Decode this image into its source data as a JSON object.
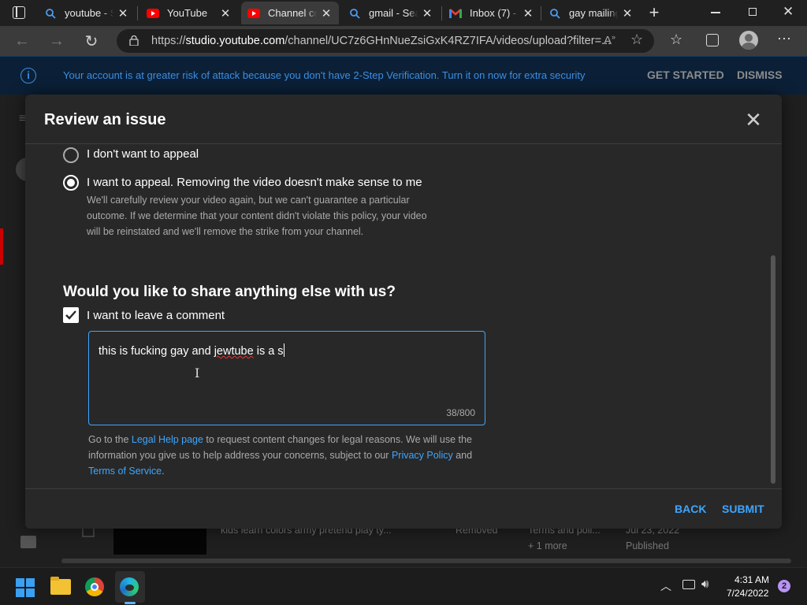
{
  "browser": {
    "tabs": [
      {
        "title": "youtube - S",
        "icon": "search-icon",
        "active": false
      },
      {
        "title": "YouTube",
        "icon": "youtube-icon",
        "active": false
      },
      {
        "title": "Channel co",
        "icon": "youtube-icon",
        "active": true
      },
      {
        "title": "gmail - Sea",
        "icon": "search-icon",
        "active": false
      },
      {
        "title": "Inbox (7) -",
        "icon": "gmail-icon",
        "active": false
      },
      {
        "title": "gay mailing",
        "icon": "search-icon",
        "active": false
      }
    ],
    "new_tab": "+",
    "url_prefix": "https://",
    "url_host": "studio.youtube.com",
    "url_rest": "/channel/UC7z6GHnNueZsiGxK4RZ7IFA/videos/upload?filter=..."
  },
  "infobar": {
    "message": "Your account is at greater risk of attack because you don't have 2-Step Verification. Turn it on now for extra security",
    "get_started": "GET STARTED",
    "dismiss": "DISMISS"
  },
  "background": {
    "row_title": "kids learn colors army pretend play ty...",
    "row_status": "Removed",
    "row_restriction": "Terms and poli...",
    "row_more": "+ 1 more",
    "row_date": "Jul 23, 2022",
    "row_published": "Published"
  },
  "dialog": {
    "title": "Review an issue",
    "option_no_appeal": "I don't want to appeal",
    "option_appeal": "I want to appeal. Removing the video doesn't make sense to me",
    "appeal_desc_1": "We'll carefully review your video again, but we can't guarantee a particular",
    "appeal_desc_2": "outcome. If we determine that your content didn't violate this policy, your video",
    "appeal_desc_3": "will be reinstated and we'll remove the strike from your channel.",
    "share_heading": "Would you like to share anything else with us?",
    "comment_checkbox": "I want to leave a comment",
    "comment_text_a": "this is fucking gay and ",
    "comment_text_b": "jewtube",
    "comment_text_c": " is a s",
    "char_count": "38/800",
    "legal_1": "Go to the ",
    "legal_link_1": "Legal Help page",
    "legal_2": " to request content changes for legal reasons. We will use the information you give us to help address your concerns, subject to our ",
    "legal_link_2": "Privacy Policy",
    "legal_3": " and ",
    "legal_link_3": "Terms of Service",
    "legal_4": ".",
    "back": "BACK",
    "submit": "SUBMIT"
  },
  "taskbar": {
    "time": "4:31 AM",
    "date": "7/24/2022",
    "notifications": "2"
  }
}
